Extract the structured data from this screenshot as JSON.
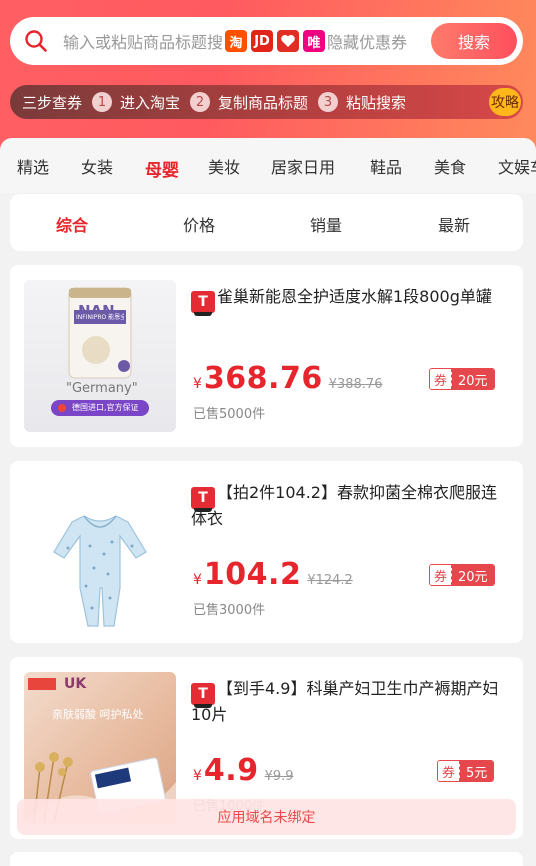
{
  "search": {
    "placeholder": "输入或粘贴商品标题搜",
    "tail": "隐藏优惠券",
    "button": "搜索",
    "platform_badges": [
      "淘",
      "JD",
      "拼",
      "唯"
    ]
  },
  "steps": {
    "lead": "三步查券",
    "items": [
      {
        "num": "1",
        "label": "进入淘宝"
      },
      {
        "num": "2",
        "label": "复制商品标题"
      },
      {
        "num": "3",
        "label": "粘贴搜索"
      }
    ],
    "guide": "攻略"
  },
  "categories": [
    "精选",
    "女装",
    "母婴",
    "美妆",
    "居家日用",
    "鞋品",
    "美食",
    "文娱车"
  ],
  "active_category": "母婴",
  "sorts": [
    "综合",
    "价格",
    "销量",
    "最新"
  ],
  "active_sort": "综合",
  "products": [
    {
      "platform": "T",
      "title": "雀巢新能恩全护适度水解1段800g单罐",
      "yen": "¥",
      "price": "368.76",
      "original": "¥388.76",
      "sold": "已售5000件",
      "coupon_label": "券",
      "coupon_value": "20元",
      "thumb_text": {
        "brand": "NAN",
        "sub": "INFINIPRO 能恩全护",
        "origin": "\"Germany\"",
        "tag": "德国进口,官方保证"
      }
    },
    {
      "platform": "T",
      "title": "【拍2件104.2】春款抑菌全棉衣爬服连体衣",
      "yen": "¥",
      "price": "104.2",
      "original": "¥124.2",
      "sold": "已售3000件",
      "coupon_label": "券",
      "coupon_value": "20元"
    },
    {
      "platform": "T",
      "title": "【到手4.9】科巢产妇卫生巾产褥期产妇10片",
      "yen": "¥",
      "price": "4.9",
      "original": "¥9.9",
      "sold": "已售1000件",
      "coupon_label": "券",
      "coupon_value": "5元",
      "thumb_text": {
        "brand": "UK",
        "slogan": "亲肤弱酸 呵护私处"
      }
    }
  ],
  "toast": "应用域名未绑定",
  "colors": {
    "accent": "#e6252c",
    "header_start": "#ff5f63",
    "header_end": "#ff8a5c",
    "guide": "#ffb71b"
  }
}
